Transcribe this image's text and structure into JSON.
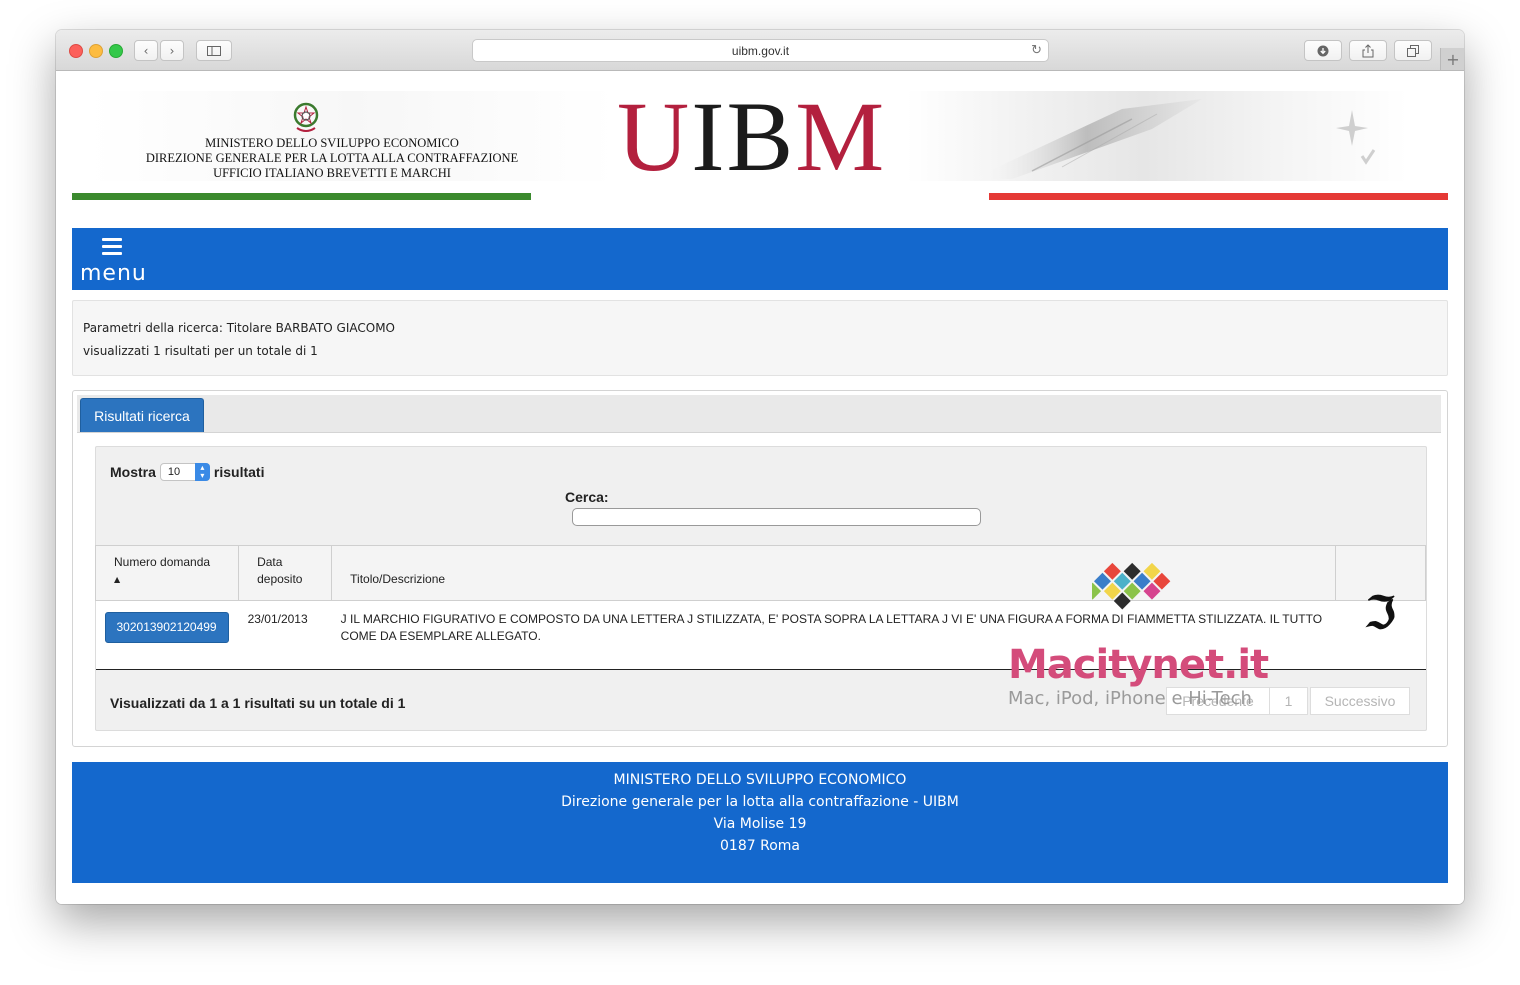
{
  "browser": {
    "url": "uibm.gov.it",
    "icons": [
      "back-icon",
      "forward-icon",
      "sidebar-icon",
      "reload-icon",
      "download-icon",
      "share-icon",
      "tabs-icon",
      "new-tab-icon"
    ]
  },
  "header": {
    "ministry_lines": [
      "MINISTERO DELLO SVILUPPO ECONOMICO",
      "DIREZIONE GENERALE PER LA LOTTA ALLA CONTRAFFAZIONE",
      "UFFICIO ITALIANO BREVETTI E MARCHI"
    ],
    "logo_text": "UIBM",
    "stripe_colors": {
      "green": "#3b8a2e",
      "red": "#e53935"
    }
  },
  "nav": {
    "menu_label": "menu",
    "bar_color": "#1468cd"
  },
  "params": {
    "line1": "Parametri della ricerca: Titolare BARBATO GIACOMO",
    "line2": "visualizzati 1 risultati per un totale di 1"
  },
  "results": {
    "tab_label": "Risultati ricerca",
    "show_label": "Mostra",
    "show_value": "10",
    "show_suffix": "risultati",
    "search_label": "Cerca:",
    "search_value": "",
    "columns": [
      "Numero domanda",
      "Data deposito",
      "Titolo/Descrizione",
      ""
    ],
    "rows": [
      {
        "numero": "302013902120499",
        "data": "23/01/2013",
        "titolo": "J IL MARCHIO FIGURATIVO E COMPOSTO DA UNA LETTERA J STILIZZATA, E' POSTA SOPRA LA LETTARA J VI E' UNA FIGURA A FORMA DI FIAMMETTA STILIZZATA. IL TUTTO COME DA ESEMPLARE ALLEGATO."
      }
    ],
    "info": "Visualizzati da 1 a 1 risultati su un totale di 1",
    "pager": {
      "prev": "Precedente",
      "page": "1",
      "next": "Successivo"
    }
  },
  "watermark": {
    "brand": "Macitynet.it",
    "tagline": "Mac, iPod, iPhone e Hi-Tech"
  },
  "footer": {
    "lines": [
      "MINISTERO DELLO SVILUPPO ECONOMICO",
      "Direzione generale per la lotta alla contraffazione - UIBM",
      "Via Molise 19",
      "0187 Roma"
    ]
  }
}
